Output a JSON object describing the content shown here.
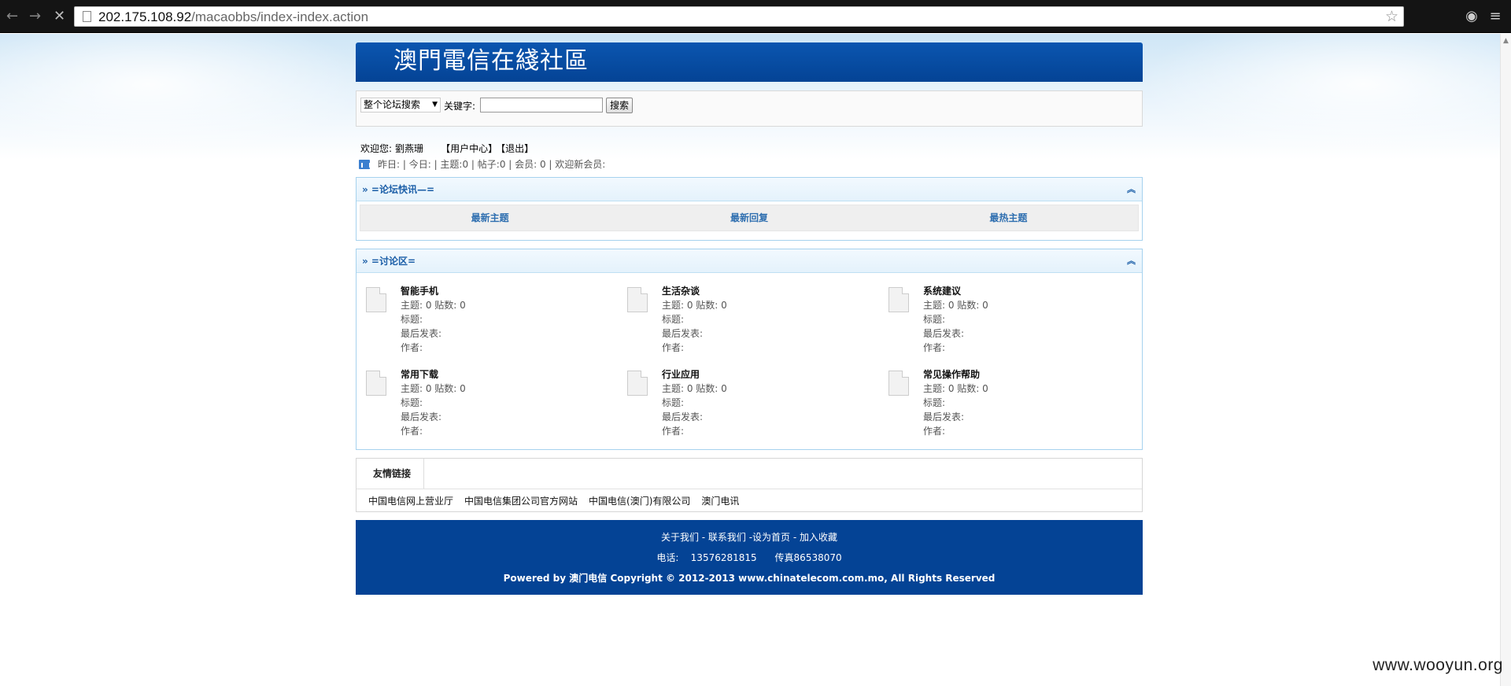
{
  "browser": {
    "url_host": "202.175.108.92",
    "url_path": "/macaobbs/index-index.action"
  },
  "site": {
    "title": "澳門電信在綫社區"
  },
  "search": {
    "scope": "整个论坛搜索",
    "keyword_label": "关键字:",
    "keyword_value": "",
    "button": "搜索"
  },
  "welcome": {
    "greeting": "欢迎您:",
    "user": "劉燕珊",
    "user_center": "【用户中心】",
    "logout": "【退出】"
  },
  "stats": {
    "text": "昨日: | 今日: | 主题:0 | 帖子:0 | 会员: 0 | 欢迎新会员:"
  },
  "news": {
    "heading": "» =论坛快讯—=",
    "toggle": "︽",
    "tabs": [
      "最新主题",
      "最新回复",
      "最热主题"
    ]
  },
  "forum": {
    "heading": "» =讨论区=",
    "toggle": "︽",
    "boards": [
      {
        "name": "智能手机",
        "counts": "主题: 0   贴数: 0",
        "title": "标题:",
        "last": "最后发表:",
        "author": "作者:"
      },
      {
        "name": "生活杂谈",
        "counts": "主题: 0   贴数: 0",
        "title": "标题:",
        "last": "最后发表:",
        "author": "作者:"
      },
      {
        "name": "系统建议",
        "counts": "主题: 0   贴数: 0",
        "title": "标题:",
        "last": "最后发表:",
        "author": "作者:"
      },
      {
        "name": "常用下载",
        "counts": "主题: 0   贴数: 0",
        "title": "标题:",
        "last": "最后发表:",
        "author": "作者:"
      },
      {
        "name": "行业应用",
        "counts": "主题: 0   贴数: 0",
        "title": "标题:",
        "last": "最后发表:",
        "author": "作者:"
      },
      {
        "name": "常见操作帮助",
        "counts": "主题: 0   贴数: 0",
        "title": "标题:",
        "last": "最后发表:",
        "author": "作者:"
      }
    ]
  },
  "links": {
    "heading": "友情链接",
    "items": [
      "中国电信网上营业厅",
      "中国电信集团公司官方网站",
      "中国电信(澳门)有限公司",
      "澳门电讯"
    ]
  },
  "footer": {
    "nav": "关于我们 - 联系我们 -设为首页 - 加入收藏",
    "phone": "电话:    13576281815      传真86538070",
    "copyright": "Powered by 澳门电信 Copyright © 2012-2013 www.chinatelecom.com.mo, All Rights Reserved"
  },
  "watermark": "www.wooyun.org"
}
